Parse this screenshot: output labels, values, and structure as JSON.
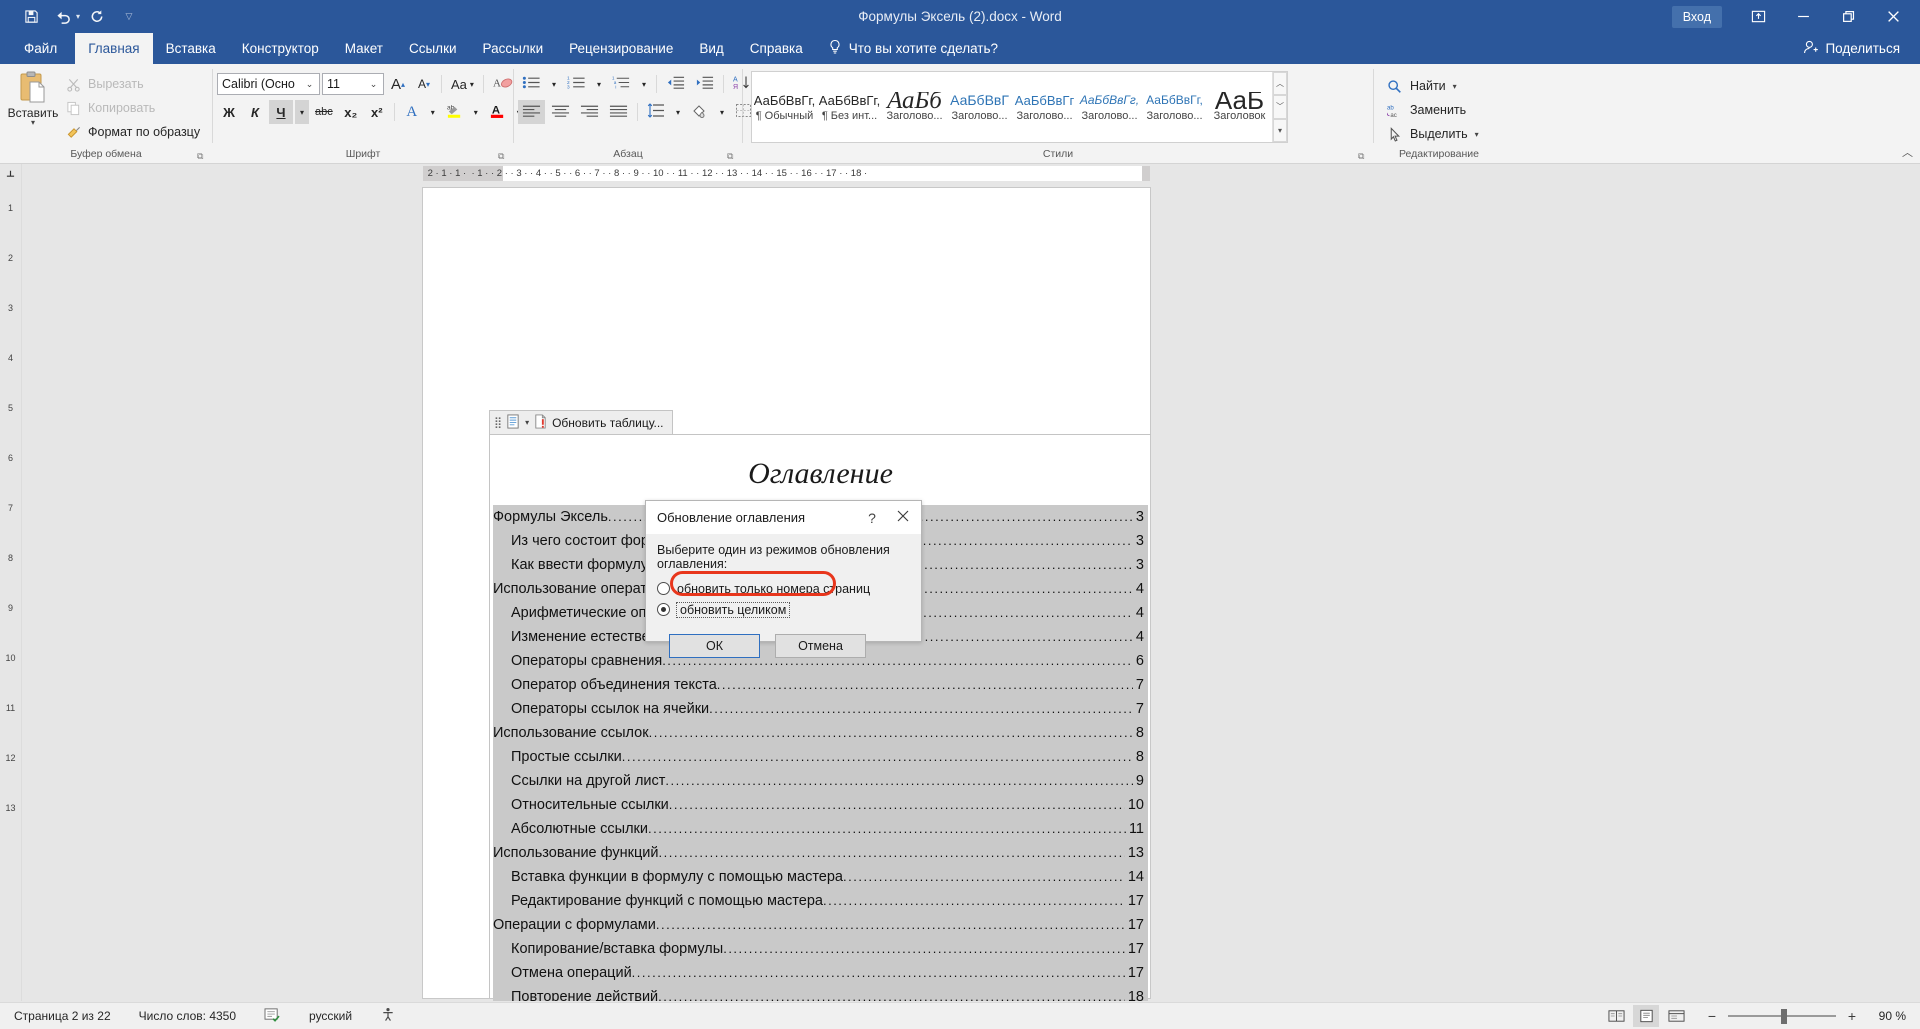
{
  "titlebar": {
    "document_title": "Формулы Эксель (2).docx  -  Word",
    "quick_access": [
      {
        "name": "save",
        "icon": "save-icon"
      },
      {
        "name": "undo",
        "icon": "undo-icon"
      },
      {
        "name": "repeat",
        "icon": "redo-icon"
      },
      {
        "name": "customize",
        "icon": "chevron-down-icon"
      }
    ],
    "signin_label": "Вход",
    "ribbon_display_options": "ribbon-display-icon",
    "minimize": "minimize-icon",
    "restore": "restore-icon",
    "close": "close-icon",
    "accent_color": "#2b579a"
  },
  "tabs": [
    {
      "id": "file",
      "label": "Файл",
      "active": false
    },
    {
      "id": "home",
      "label": "Главная",
      "active": true
    },
    {
      "id": "insert",
      "label": "Вставка",
      "active": false
    },
    {
      "id": "design",
      "label": "Конструктор",
      "active": false
    },
    {
      "id": "layout",
      "label": "Макет",
      "active": false
    },
    {
      "id": "references",
      "label": "Ссылки",
      "active": false
    },
    {
      "id": "mailings",
      "label": "Рассылки",
      "active": false
    },
    {
      "id": "review",
      "label": "Рецензирование",
      "active": false
    },
    {
      "id": "view",
      "label": "Вид",
      "active": false
    },
    {
      "id": "help",
      "label": "Справка",
      "active": false
    }
  ],
  "tellme": {
    "label": "Что вы хотите сделать?",
    "icon": "lightbulb-icon"
  },
  "share": {
    "label": "Поделиться",
    "icon": "share-person-icon"
  },
  "ribbon": {
    "groups": [
      {
        "id": "clipboard",
        "label": "Буфер обмена"
      },
      {
        "id": "font",
        "label": "Шрифт"
      },
      {
        "id": "paragraph",
        "label": "Абзац"
      },
      {
        "id": "styles",
        "label": "Стили"
      },
      {
        "id": "editing",
        "label": "Редактирование"
      }
    ],
    "clipboard": {
      "paste_label": "Вставить",
      "cut_label": "Вырезать",
      "copy_label": "Копировать",
      "format_painter_label": "Формат по образцу"
    },
    "font": {
      "font_family_value": "Calibri (Осно",
      "font_size_value": "11",
      "grow_font": "A",
      "shrink_font": "A",
      "change_case": "Aa",
      "clear_format": "clear-formatting-icon",
      "bold": "Ж",
      "italic": "К",
      "underline": "Ч",
      "strikethrough": "abc",
      "subscript": "x₂",
      "superscript": "x²",
      "text_effects": "A",
      "highlight": "ab",
      "font_color": "A"
    },
    "paragraph": {
      "bullets": "bullet-list-icon",
      "numbering": "numbered-list-icon",
      "multilevel": "multilevel-list-icon",
      "decrease_indent": "decrease-indent-icon",
      "increase_indent": "increase-indent-icon",
      "sort": "sort-icon",
      "show_marks": "¶",
      "align_left": "align-left-icon",
      "align_center": "align-center-icon",
      "align_right": "align-right-icon",
      "justify": "justify-icon",
      "line_spacing": "line-spacing-icon",
      "shading": "shading-icon",
      "borders": "borders-icon"
    },
    "styles": {
      "items": [
        {
          "preview": "АаБбВвГг,",
          "name": "¶ Обычный",
          "style": "normal"
        },
        {
          "preview": "АаБбВвГг,",
          "name": "¶ Без инт...",
          "style": "normal"
        },
        {
          "preview": "АаБб",
          "name": "Заголово...",
          "style": "h1"
        },
        {
          "preview": "АаБбВвГ",
          "name": "Заголово...",
          "style": "h2"
        },
        {
          "preview": "АаБбВвГг",
          "name": "Заголово...",
          "style": "h3"
        },
        {
          "preview": "АаБбВвГг,",
          "name": "Заголово...",
          "style": "h4"
        },
        {
          "preview": "АаБбВвГг,",
          "name": "Заголово...",
          "style": "h5"
        },
        {
          "preview": "АаБ",
          "name": "Заголовок",
          "style": "title"
        }
      ]
    },
    "editing": {
      "find_label": "Найти",
      "replace_label": "Заменить",
      "select_label": "Выделить"
    }
  },
  "ruler": {
    "left_margin_marker": "2",
    "ticks": "2  ·  1  ·  1  ·     ·  1  ·  ·  2  ·  ·  3  ·  ·  4  ·  ·  5  ·  ·  6  ·  ·  7  ·  ·  8  ·  ·  9  ·  ·  10  ·  ·  11  ·  ·  12  ·  ·  13  ·  ·  14  ·  ·  15  ·  ·  16  ·  ·  17  ·  ·  18  ·",
    "vertical": [
      "1",
      "2",
      "3",
      "4",
      "5",
      "6",
      "7",
      "8",
      "9",
      "10",
      "11",
      "12",
      "13"
    ]
  },
  "document": {
    "toc_handle_label": "Обновить таблицу...",
    "toc_handle_icons": [
      "grip-icon",
      "toc-icon",
      "chevron-down-icon",
      "update-table-icon"
    ],
    "toc_title": "Оглавление",
    "entries": [
      {
        "text": "Формулы Эксель",
        "page": "3",
        "level": 1
      },
      {
        "text": "Из чего состоит формула",
        "page": "3",
        "level": 2
      },
      {
        "text": "Как ввести формулу",
        "page": "3",
        "level": 2
      },
      {
        "text": "Использование операторов",
        "page": "4",
        "level": 1
      },
      {
        "text": "Арифметические операторы",
        "page": "4",
        "level": 2
      },
      {
        "text": "Изменение естественного порядка",
        "page": "4",
        "level": 2
      },
      {
        "text": "Операторы сравнения",
        "page": "6",
        "level": 2
      },
      {
        "text": "Оператор объединения текста",
        "page": "7",
        "level": 2
      },
      {
        "text": "Операторы ссылок на ячейки",
        "page": "7",
        "level": 2
      },
      {
        "text": "Использование ссылок",
        "page": "8",
        "level": 1
      },
      {
        "text": "Простые ссылки",
        "page": "8",
        "level": 2
      },
      {
        "text": "Ссылки на другой лист",
        "page": "9",
        "level": 2
      },
      {
        "text": "Относительные ссылки",
        "page": "10",
        "level": 2
      },
      {
        "text": "Абсолютные ссылки",
        "page": "11",
        "level": 2
      },
      {
        "text": "Использование функций",
        "page": "13",
        "level": 1
      },
      {
        "text": "Вставка функции в формулу с помощью мастера",
        "page": "14",
        "level": 2
      },
      {
        "text": "Редактирование функций с помощью мастера",
        "page": "17",
        "level": 2
      },
      {
        "text": "Операции с формулами",
        "page": "17",
        "level": 1
      },
      {
        "text": "Копирование/вставка формулы",
        "page": "17",
        "level": 2
      },
      {
        "text": "Отмена операций",
        "page": "17",
        "level": 2
      },
      {
        "text": "Повторение действий",
        "page": "18",
        "level": 2
      }
    ]
  },
  "dialog": {
    "title": "Обновление оглавления",
    "help_icon": "?",
    "close_icon": "close-icon",
    "prompt": "Выберите один из режимов обновления оглавления:",
    "options": [
      {
        "label": "обновить только номера страниц",
        "selected": false
      },
      {
        "label": "обновить целиком",
        "selected": true
      }
    ],
    "ok_label": "ОК",
    "cancel_label": "Отмена",
    "annotation_color": "#e8361c"
  },
  "statusbar": {
    "page_info": "Страница 2 из 22",
    "word_count": "Число слов: 4350",
    "proofing_icon": "proofing-icon",
    "language": "русский",
    "accessibility_icon": "accessibility-icon",
    "views": [
      {
        "name": "read-mode",
        "icon": "read-mode-icon",
        "active": false
      },
      {
        "name": "print-layout",
        "icon": "print-layout-icon",
        "active": true
      },
      {
        "name": "web-layout",
        "icon": "web-layout-icon",
        "active": false
      }
    ],
    "zoom_out": "−",
    "zoom_in": "+",
    "zoom_value": "90 %"
  }
}
